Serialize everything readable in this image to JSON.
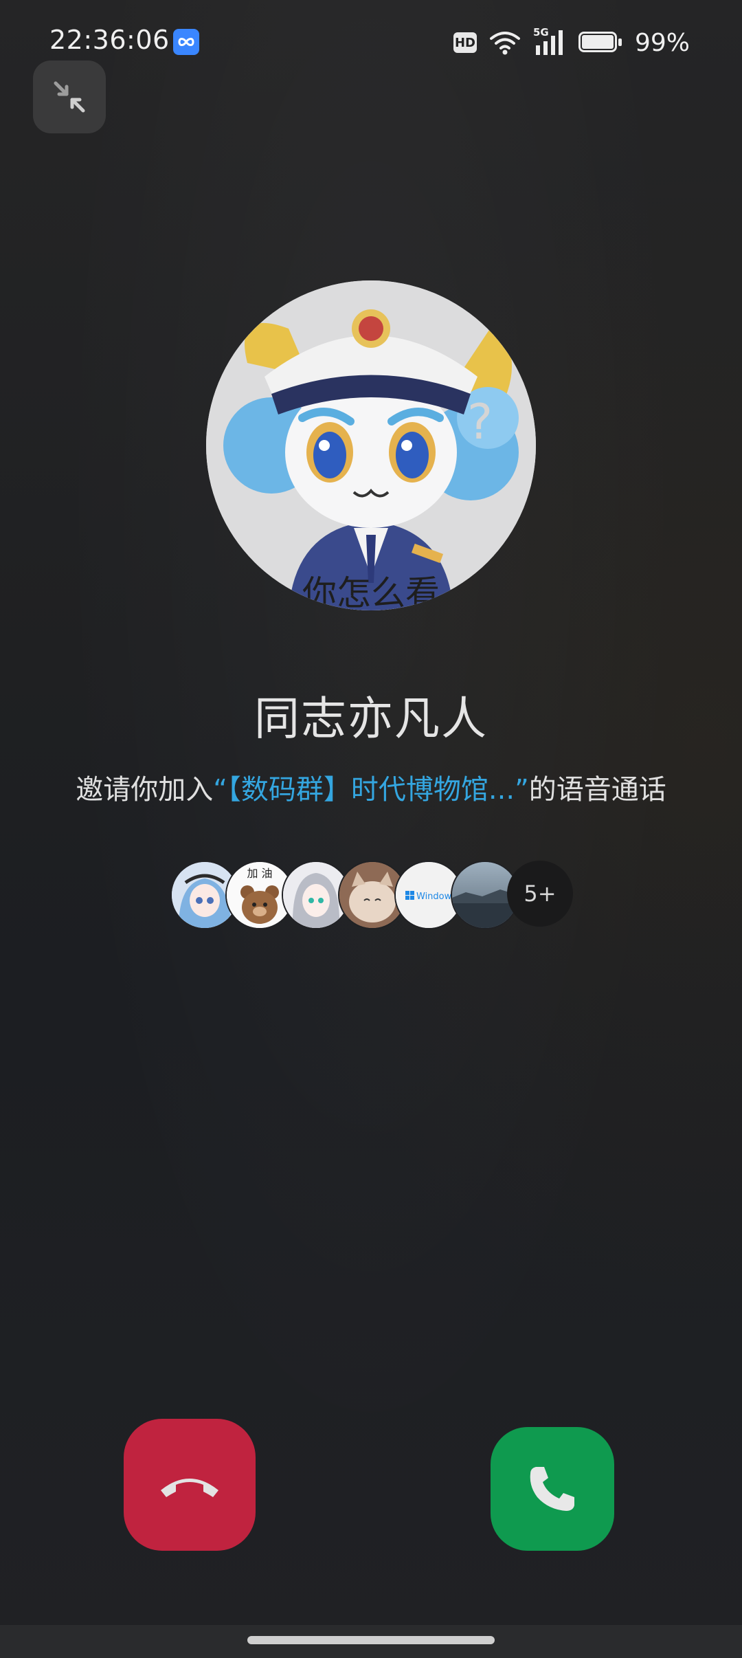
{
  "status_bar": {
    "time": "22:36:06",
    "hd_label": "HD",
    "network_label": "5G",
    "battery_percent": "99%",
    "battery_level": 0.99,
    "app_badge_color": "#3a86ff"
  },
  "call": {
    "minimize_icon": "minimize-arrows-icon",
    "caller_name": "同志亦凡人",
    "avatar_caption": "你怎么看",
    "invite_prefix": "邀请你加入",
    "group_name": "“【数码群】时代博物馆...”",
    "invite_suffix": "的语音通话",
    "participants_more": "5+",
    "decline_icon": "hang-up-icon",
    "accept_icon": "phone-icon",
    "decline_color": "#c0233f",
    "accept_color": "#0f9a4f",
    "accent_color": "#34a6e0"
  },
  "participants": [
    {
      "icon": "anime-girl-blue-avatar"
    },
    {
      "label": "加 油",
      "icon": "bear-avatar"
    },
    {
      "icon": "anime-girl-silver-avatar"
    },
    {
      "icon": "cat-avatar"
    },
    {
      "label": "Windows",
      "icon": "windows-logo-avatar"
    },
    {
      "icon": "landscape-avatar"
    }
  ]
}
